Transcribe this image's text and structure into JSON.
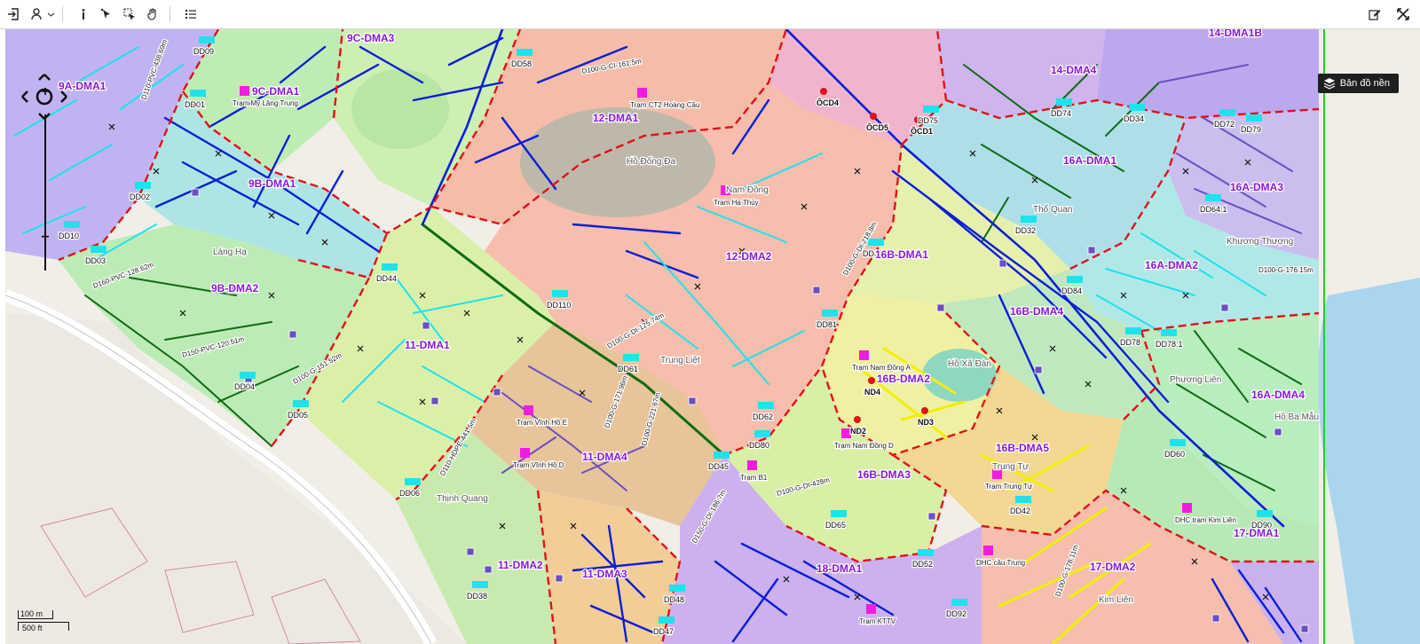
{
  "toolbar": {
    "tools": [
      "login-icon",
      "user-location-icon",
      "chevron-down-icon",
      "info-icon",
      "select-point-icon",
      "select-area-icon",
      "pan-hand-icon",
      "legend-list-icon"
    ],
    "right_tools": [
      "edit-icon",
      "fullscreen-icon"
    ]
  },
  "basemap_button": {
    "label": "Bản đồ nền"
  },
  "scale": {
    "metric": "100 m",
    "imperial": "500 ft"
  },
  "colors": {
    "zone_purple": "#b8a4f0",
    "zone_green": "#b9ecb0",
    "zone_salmon": "#f6b9a4",
    "zone_cyan": "#a6e6e6",
    "zone_yellow": "#eef0a0",
    "zone_blue": "#a9c6f0",
    "zone_lime": "#d6f0a0",
    "zone_orange": "#f4c890",
    "pipe_blue": "#0a1fd6",
    "pipe_cyan": "#1ee3ec",
    "pipe_green": "#0e6a14",
    "pipe_purple": "#6a4fc0",
    "pipe_yellow": "#f2f000",
    "boundary_red": "#e0121a",
    "label_purple": "#8a18d8",
    "marker_magenta": "#f01de0"
  },
  "dma_labels": [
    "9A-DMA1",
    "9C-DMA3",
    "9C-DMA1",
    "9B-DMA1",
    "9B-DMA2",
    "11-DMA1",
    "11-DMA2",
    "11-DMA3",
    "11-DMA4",
    "12-DMA1",
    "12-DMA2",
    "14-DMA1B",
    "14-DMA4",
    "16A-DMA1",
    "16A-DMA2",
    "16A-DMA3",
    "16A-DMA4",
    "16B-DMA1",
    "16B-DMA2",
    "16B-DMA3",
    "16B-DMA4",
    "16B-DMA5",
    "17-DMA1",
    "17-DMA2",
    "18-DMA1"
  ],
  "node_labels": [
    "DD09",
    "DD01",
    "DD02",
    "DD10",
    "DD03",
    "DD44",
    "DD04",
    "DD05",
    "DD06",
    "DD110",
    "DD61",
    "DD45",
    "DD62",
    "DD80",
    "DD65",
    "DD52",
    "DD48",
    "DD47",
    "DD38",
    "DD58",
    "DD75",
    "DD74",
    "DD34",
    "DD72",
    "DD79",
    "DD64.1",
    "DD32",
    "DD82",
    "DD84",
    "DD78",
    "DD78.1",
    "DD81",
    "DD42",
    "DD92",
    "DD90",
    "DD60"
  ],
  "place_labels": [
    "Hồ Đống Đa",
    "Trung Liệt",
    "Thịnh Quang",
    "Trung Tự",
    "Kim Liên",
    "Phương Liên",
    "Hồ Xã Đàn",
    "Hồ Ba Mẫu",
    "Láng Hạ",
    "Nam Đồng",
    "Thổ Quan",
    "Khương Thượng"
  ],
  "station_labels": [
    "Trạm Mỹ Lăng Trung",
    "Trạm CT2 Hoàng Cầu",
    "Trạm Hạ Thủy",
    "Trạm Vĩnh Hồ E",
    "Trạm Vĩnh Hồ D",
    "Trạm B1",
    "Trạm Nam Đồng A",
    "Trạm Nam Đồng D",
    "Trạm Trung Tự",
    "DHC trạm Kim Liên",
    "DHC cầu Trung",
    "Trạm KTTV"
  ],
  "meter_labels": [
    "ND2",
    "ND3",
    "ND4",
    "ÔCD1",
    "ÔCD4",
    "ÔCD5"
  ],
  "pipe_labels": [
    "D100-G-CI-161.5m",
    "D110-PVC-438.69m",
    "D160-PVC-128.62m",
    "D150-PVC-120.51m",
    "D100-G-151.52m",
    "D100-G-DI-125.74m",
    "D100-G-171.96m",
    "D100-G-221.67m",
    "D100-G-DI-428m",
    "D100-G-DI-218.8m",
    "D100-G-176.15m",
    "D100-G-178.11m",
    "D150-G-DI-186.7m",
    "D110-HDPE-441.5m"
  ]
}
